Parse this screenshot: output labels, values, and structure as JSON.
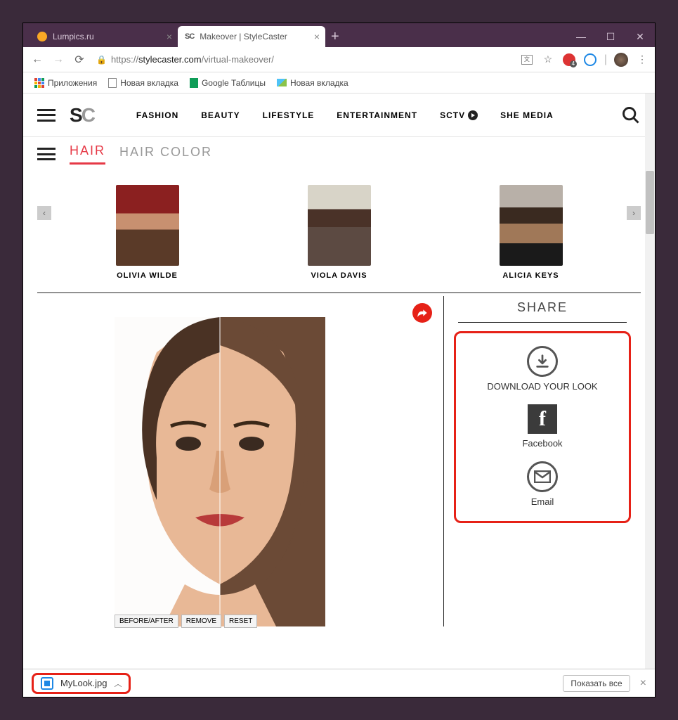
{
  "window": {
    "tabs": [
      {
        "title": "Lumpics.ru"
      },
      {
        "title": "Makeover | StyleCaster"
      }
    ],
    "newtab": "+",
    "min": "—",
    "max": "☐",
    "close": "✕"
  },
  "addr": {
    "scheme": "https://",
    "host": "stylecaster.com",
    "path": "/virtual-makeover/"
  },
  "bookmarks": {
    "apps": "Приложения",
    "items": [
      "Новая вкладка",
      "Google Таблицы",
      "Новая вкладка"
    ]
  },
  "nav": {
    "items": [
      "FASHION",
      "BEAUTY",
      "LIFESTYLE",
      "ENTERTAINMENT"
    ],
    "sctv": "SCTV",
    "she": "SHE MEDIA"
  },
  "subnav": {
    "hair": "HAIR",
    "haircolor": "HAIR COLOR"
  },
  "celebs": [
    {
      "name": "OLIVIA WILDE"
    },
    {
      "name": "VIOLA DAVIS"
    },
    {
      "name": "ALICIA KEYS"
    }
  ],
  "tools": {
    "ba": "BEFORE/AFTER",
    "remove": "REMOVE",
    "reset": "RESET"
  },
  "share": {
    "header": "SHARE",
    "download": "DOWNLOAD YOUR LOOK",
    "facebook": "Facebook",
    "email": "Email"
  },
  "download": {
    "file": "MyLook.jpg",
    "showall": "Показать все"
  }
}
